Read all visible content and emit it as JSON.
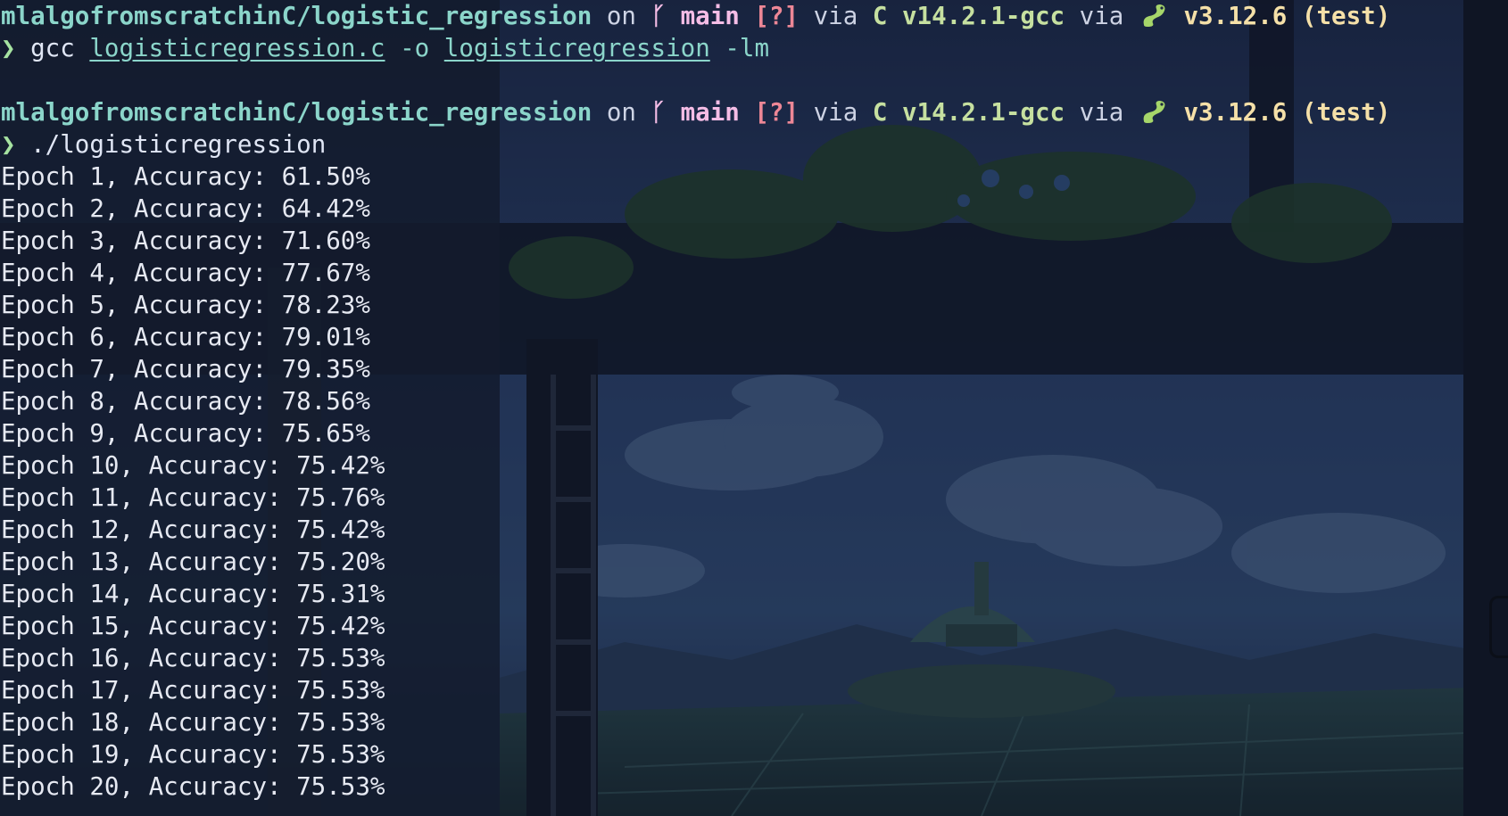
{
  "prompts": [
    {
      "path": "mlalgofromscratchinC/logistic_regression",
      "on_word": "on",
      "branch_icon": "git-branch-icon",
      "branch": "main",
      "status": "[?]",
      "via1": "via",
      "lang_letter": "C",
      "lang_version": "v14.2.1-gcc",
      "via2": "via",
      "python_icon": "python-snake-icon",
      "python_version": "v3.12.6",
      "venv": "(test)"
    },
    {
      "path": "mlalgofromscratchinC/logistic_regression",
      "on_word": "on",
      "branch_icon": "git-branch-icon",
      "branch": "main",
      "status": "[?]",
      "via1": "via",
      "lang_letter": "C",
      "lang_version": "v14.2.1-gcc",
      "via2": "via",
      "python_icon": "python-snake-icon",
      "python_version": "v3.12.6",
      "venv": "(test)"
    }
  ],
  "prompt_symbol": "❯",
  "command1": {
    "program": "gcc",
    "source": "logisticregression.c",
    "output_flag": "-o",
    "output": "logisticregression",
    "lib_flag": "-lm"
  },
  "command2": {
    "program": "./logisticregression"
  },
  "output_lines": [
    "Epoch 1, Accuracy: 61.50%",
    "Epoch 2, Accuracy: 64.42%",
    "Epoch 3, Accuracy: 71.60%",
    "Epoch 4, Accuracy: 77.67%",
    "Epoch 5, Accuracy: 78.23%",
    "Epoch 6, Accuracy: 79.01%",
    "Epoch 7, Accuracy: 79.35%",
    "Epoch 8, Accuracy: 78.56%",
    "Epoch 9, Accuracy: 75.65%",
    "Epoch 10, Accuracy: 75.42%",
    "Epoch 11, Accuracy: 75.76%",
    "Epoch 12, Accuracy: 75.42%",
    "Epoch 13, Accuracy: 75.20%",
    "Epoch 14, Accuracy: 75.31%",
    "Epoch 15, Accuracy: 75.42%",
    "Epoch 16, Accuracy: 75.53%",
    "Epoch 17, Accuracy: 75.53%",
    "Epoch 18, Accuracy: 75.53%",
    "Epoch 19, Accuracy: 75.53%",
    "Epoch 20, Accuracy: 75.53%"
  ],
  "colors": {
    "path": "#8bd5ca",
    "branch": "#f5bde6",
    "status": "#ed8796",
    "lang": "#c6e0a0",
    "python": "#f5e0a8",
    "text": "#e6e9f2"
  }
}
